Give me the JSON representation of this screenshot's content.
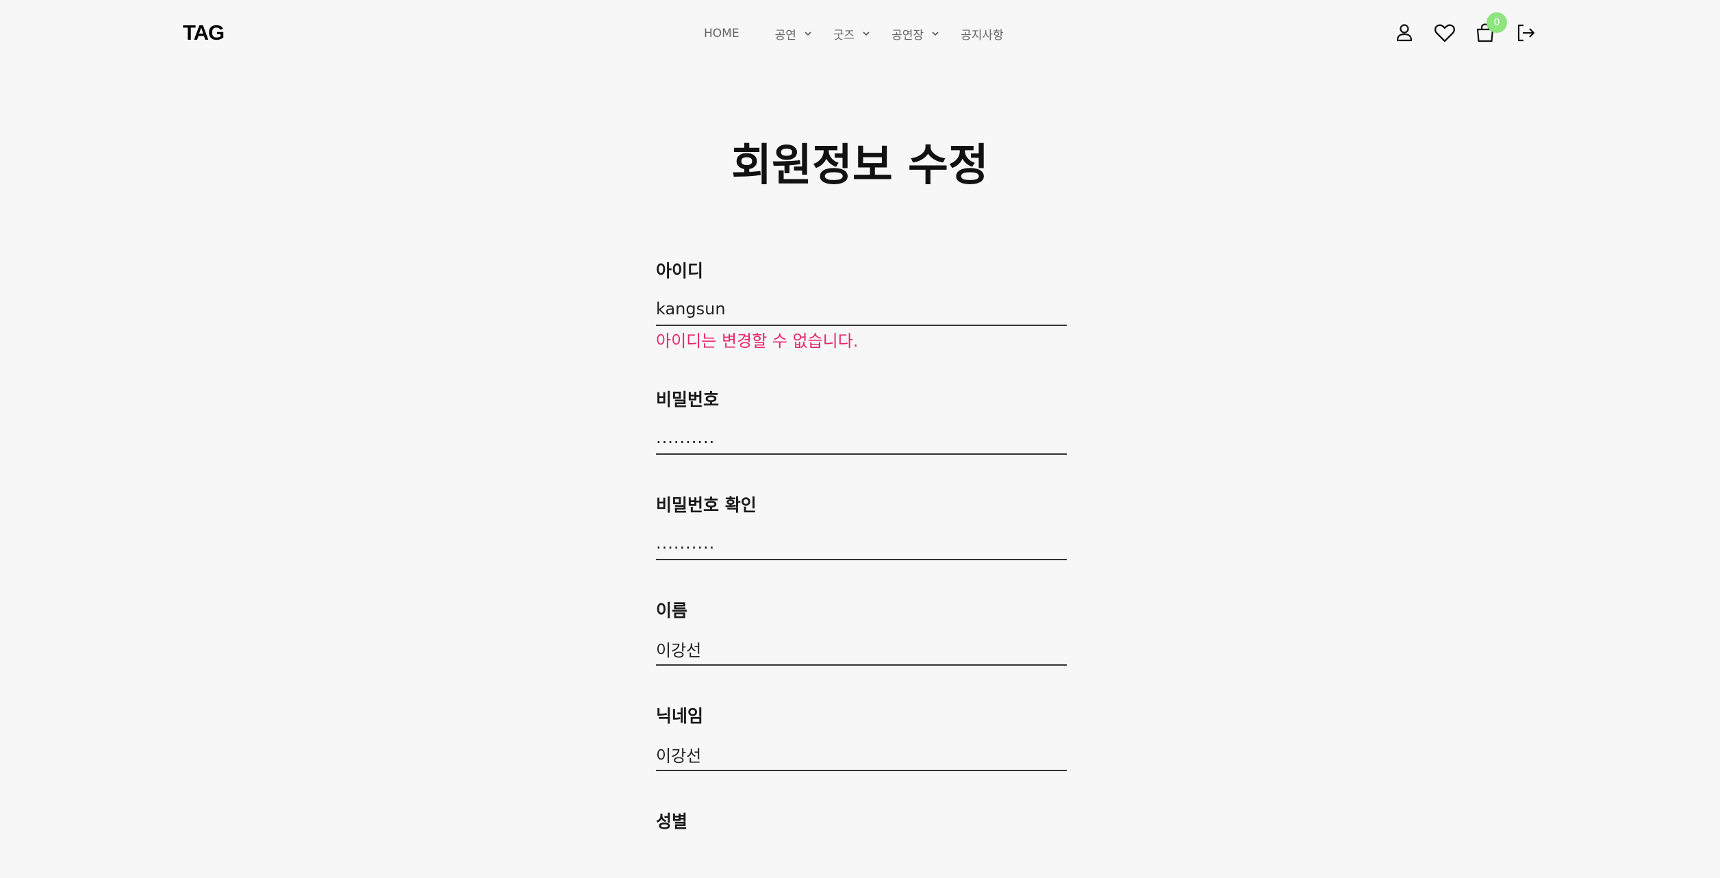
{
  "header": {
    "logo": "TAG",
    "nav": [
      {
        "label": "HOME"
      },
      {
        "label": "공연"
      },
      {
        "label": "굿즈"
      },
      {
        "label": "공연장"
      },
      {
        "label": "공지사항"
      }
    ],
    "cart_count": "0",
    "icons": [
      "user-icon",
      "heart-icon",
      "cart-icon",
      "logout-icon"
    ]
  },
  "page": {
    "title": "회원정보 수정"
  },
  "form": {
    "id": {
      "label": "아이디",
      "value": "kangsun",
      "note": "아이디는 변경할 수 없습니다."
    },
    "password": {
      "label": "비밀번호",
      "value": ".........."
    },
    "password_confirm": {
      "label": "비밀번호 확인",
      "value": ".........."
    },
    "name": {
      "label": "이름",
      "value": "이강선"
    },
    "nickname": {
      "label": "닉네임",
      "value": "이강선"
    },
    "gender": {
      "label": "성별"
    }
  },
  "colors": {
    "background": "#f7f7f7",
    "note": "#e8276f",
    "badge": "#8ee57e"
  }
}
